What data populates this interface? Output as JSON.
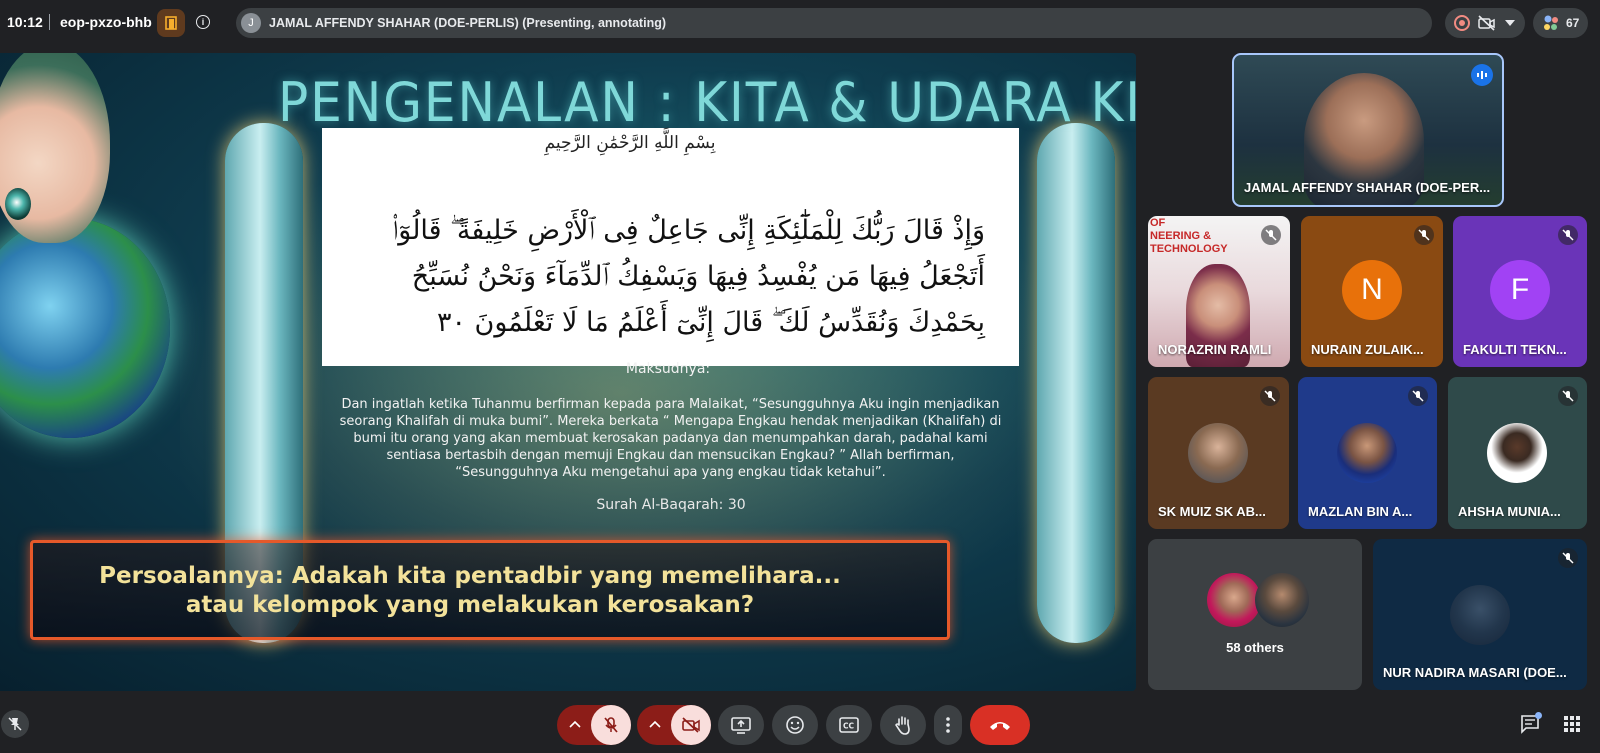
{
  "topbar": {
    "time": "10:12",
    "meeting_code": "eop-pxzo-bhb",
    "presenter_initial": "J",
    "presenter_status": "JAMAL AFFENDY SHAHAR (DOE-PERLIS) (Presenting, annotating)",
    "participant_count": "67"
  },
  "slide": {
    "title": "PENGENALAN : KITA & UDARA KITA",
    "bismillah": "بِسْمِ اللَّهِ الرَّحْمَٰنِ الرَّحِيمِ",
    "arabic_verse": "وَإِذْ قَالَ رَبُّكَ لِلْمَلَٰٓئِكَةِ إِنِّى جَاعِلٌ فِى ٱلْأَرْضِ خَلِيفَةً ۖ قَالُوٓا۟ أَتَجْعَلُ فِيهَا مَن يُفْسِدُ فِيهَا وَيَسْفِكُ ٱلدِّمَآءَ وَنَحْنُ نُسَبِّحُ بِحَمْدِكَ وَنُقَدِّسُ لَكَ ۖ قَالَ إِنِّىٓ أَعْلَمُ مَا لَا تَعْلَمُونَ ٣٠",
    "meaning_label": "Maksudnya:",
    "translation": "Dan ingatlah ketika Tuhanmu berfirman kepada para Malaikat, “Sesungguhnya Aku ingin menjadikan seorang Khalifah di muka bumi”. Mereka berkata “ Mengapa Engkau hendak menjadikan (Khalifah) di bumi itu orang yang akan membuat kerosakan padanya dan menumpahkan darah, padahal kami sentiasa bertasbih dengan memuji Engkau dan mensucikan Engkau? ” Allah berfirman, “Sesungguhnya Aku mengetahui apa yang engkau tidak ketahui”.",
    "surah": "Surah Al-Baqarah: 30",
    "question_line1": "Persoalannya: Adakah kita pentadbir yang memelihara...",
    "question_line2": "atau kelompok yang melakukan kerosakan?"
  },
  "participants": {
    "presenter": "JAMAL AFFENDY SHAHAR (DOE-PER...",
    "tiles": [
      {
        "name": "NORAZRIN RAMLI"
      },
      {
        "name": "NURAIN ZULAIK...",
        "initial": "N",
        "color": "#e8710a",
        "bg": "#8a4a12"
      },
      {
        "name": "FAKULTI TEKN...",
        "initial": "F",
        "color": "#a142f4",
        "bg": "#6a34b8"
      },
      {
        "name": "SK MUIZ SK AB..."
      },
      {
        "name": "MAZLAN BIN A..."
      },
      {
        "name": "AHSHA MUNIA..."
      },
      {
        "name": "NUR NADIRA MASARI (DOE..."
      }
    ],
    "others_label": "58 others",
    "banner_partial": "OF\nNEERING & TECHNOLOGY"
  },
  "colors": {
    "background": "#202124",
    "control": "#3c4043",
    "danger": "#d93025",
    "muted_red": "#8c1d18"
  }
}
